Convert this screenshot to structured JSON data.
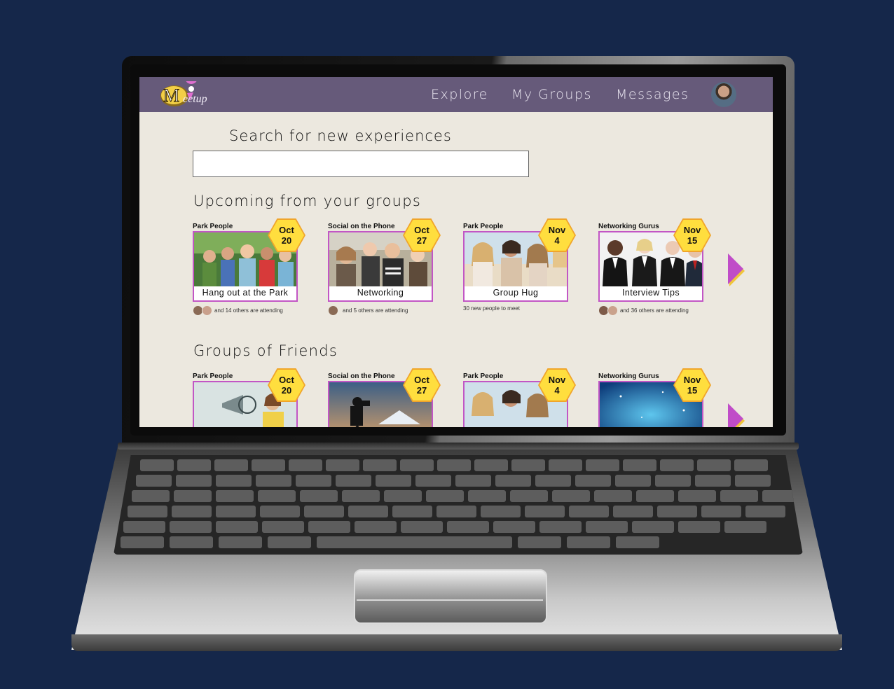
{
  "app": {
    "logo_text": "Meetup"
  },
  "nav": {
    "links": [
      "Explore",
      "My Groups",
      "Messages"
    ]
  },
  "search": {
    "heading": "Search for new experiences",
    "value": "",
    "placeholder": ""
  },
  "upcoming": {
    "heading": "Upcoming from your groups",
    "cards": [
      {
        "group": "Park People",
        "month": "Oct",
        "day": "20",
        "title": "Hang out at the Park",
        "attendance": "and 14 others are attending"
      },
      {
        "group": "Social on the Phone",
        "month": "Oct",
        "day": "27",
        "title": "Networking",
        "attendance": "and 5 others are attending"
      },
      {
        "group": "Park People",
        "month": "Nov",
        "day": "4",
        "title": "Group Hug",
        "attendance": "30 new people to meet"
      },
      {
        "group": "Networking Gurus",
        "month": "Nov",
        "day": "15",
        "title": "Interview Tips",
        "attendance": "and 36 others are attending"
      }
    ]
  },
  "friends": {
    "heading": "Groups of Friends",
    "cards": [
      {
        "group": "Park People",
        "month": "Oct",
        "day": "20"
      },
      {
        "group": "Social on the Phone",
        "month": "Oct",
        "day": "27"
      },
      {
        "group": "Park People",
        "month": "Nov",
        "day": "4"
      },
      {
        "group": "Networking Gurus",
        "month": "Nov",
        "day": "15"
      }
    ]
  },
  "colors": {
    "nav_bg": "#665a7a",
    "page_bg": "#ece8df",
    "card_border": "#c256c5",
    "date_badge": "#ffde3e",
    "arrow": "#c04cc8"
  }
}
